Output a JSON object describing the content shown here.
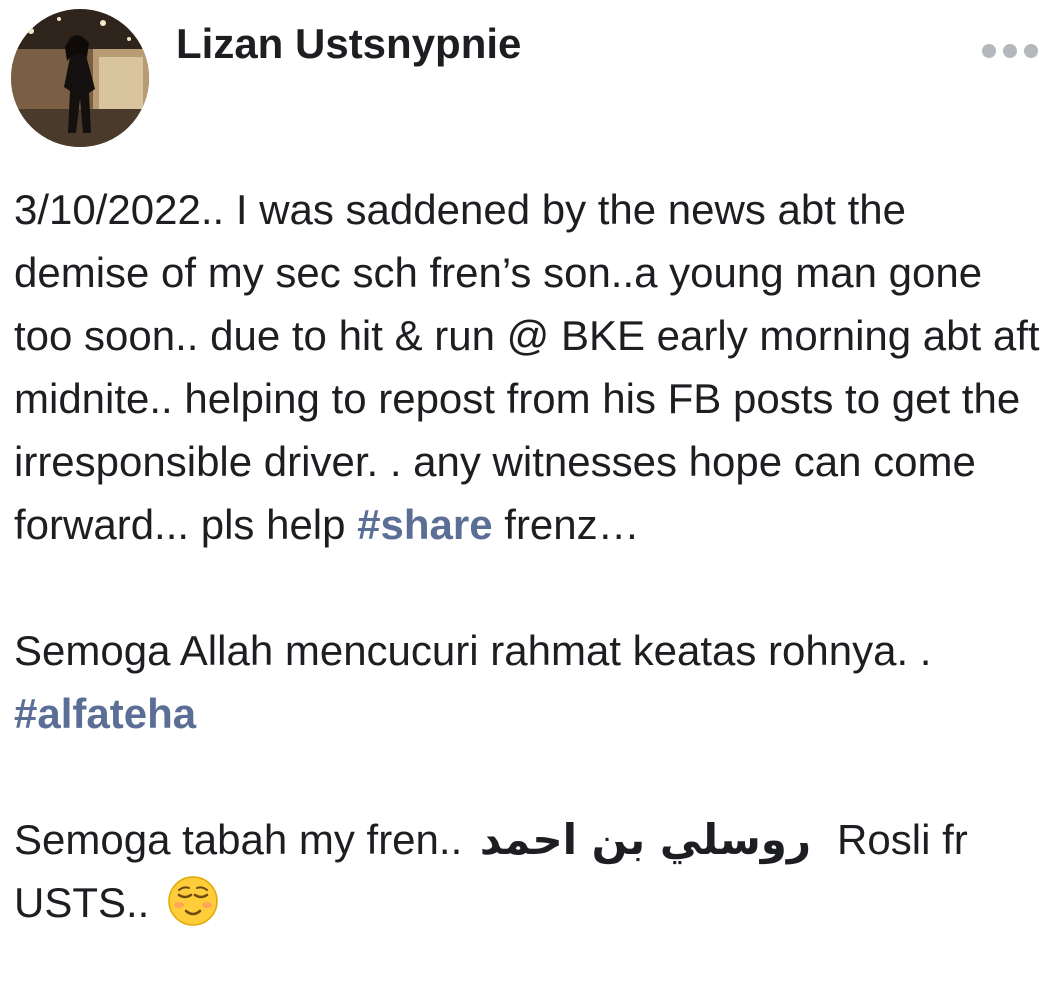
{
  "post": {
    "author_name": "Lizan Ustsnypnie",
    "more_icon": "more-horizontal-icon",
    "paragraph1": {
      "text_before": "3/10/2022.. I was saddened by the news abt the demise of my sec sch fren’s son..a young man gone too soon.. due to hit & run @ BKE early morning abt aft midnite.. helping to repost from his FB posts to get the irresponsible driver. . any witnesses hope can come forward...  pls help ",
      "hashtag": "#share",
      "text_after": " frenz…"
    },
    "paragraph2": {
      "text_before": "Semoga Allah mencucuri rahmat keatas rohnya. . ",
      "hashtag": "#alfateha"
    },
    "paragraph3": {
      "text_before": "Semoga tabah my fren.. ",
      "arabic_name": "روسلي بن احمد",
      "text_after": "Rosli fr USTS.. ",
      "emoji": "relieved-face-emoji"
    },
    "colors": {
      "hashtag": "#5b6e96",
      "text": "#1c1e21",
      "more_dots": "#b4b7bb"
    }
  }
}
